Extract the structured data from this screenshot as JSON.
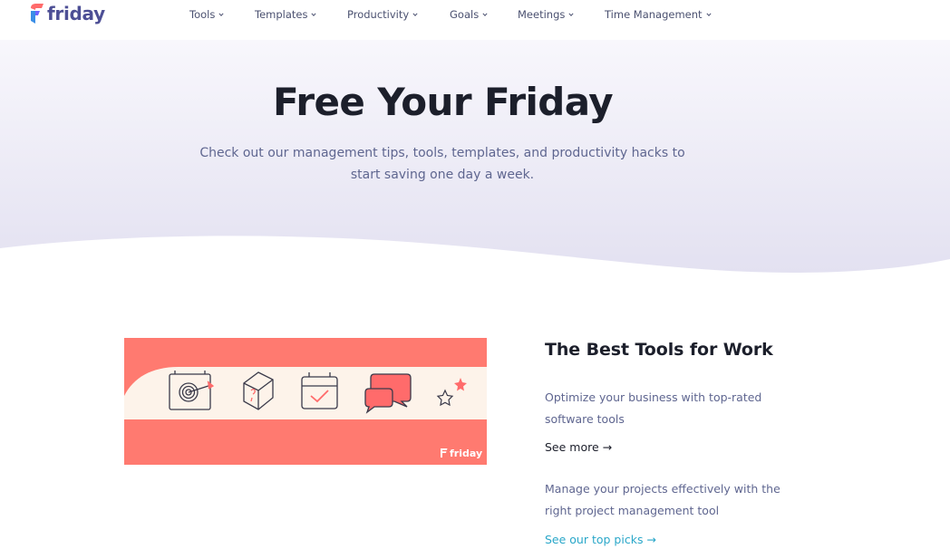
{
  "brand": {
    "name": "friday"
  },
  "nav": {
    "items": [
      {
        "label": "Tools"
      },
      {
        "label": "Templates"
      },
      {
        "label": "Productivity"
      },
      {
        "label": "Goals"
      },
      {
        "label": "Meetings"
      },
      {
        "label": "Time Management"
      }
    ]
  },
  "hero": {
    "title": "Free Your Friday",
    "subtitle_line1": "Check out our management tips, tools, templates, and productivity hacks to",
    "subtitle_line2": "start saving one day a week."
  },
  "feature": {
    "title": "The Best Tools for Work",
    "description_1_line1": "Optimize your business with top-rated",
    "description_1_line2": "software tools",
    "link_1": "See more →",
    "description_2_line1": "Manage your projects effectively with the",
    "description_2_line2": "right project management tool",
    "link_2": "See our top picks →",
    "banner": {
      "logo_text": "friday",
      "icons": [
        "target-icon",
        "puzzle-cube-icon",
        "calendar-check-icon",
        "chat-bubbles-icon",
        "stars-icon"
      ]
    }
  },
  "colors": {
    "brand_purple": "#4d4f95",
    "hero_tint": "#e6e5f3",
    "coral": "#ff7a70",
    "cream": "#fdf3ea",
    "link_teal": "#2aa7c9",
    "body_text": "#5f6690",
    "heading": "#1c1f2b"
  }
}
